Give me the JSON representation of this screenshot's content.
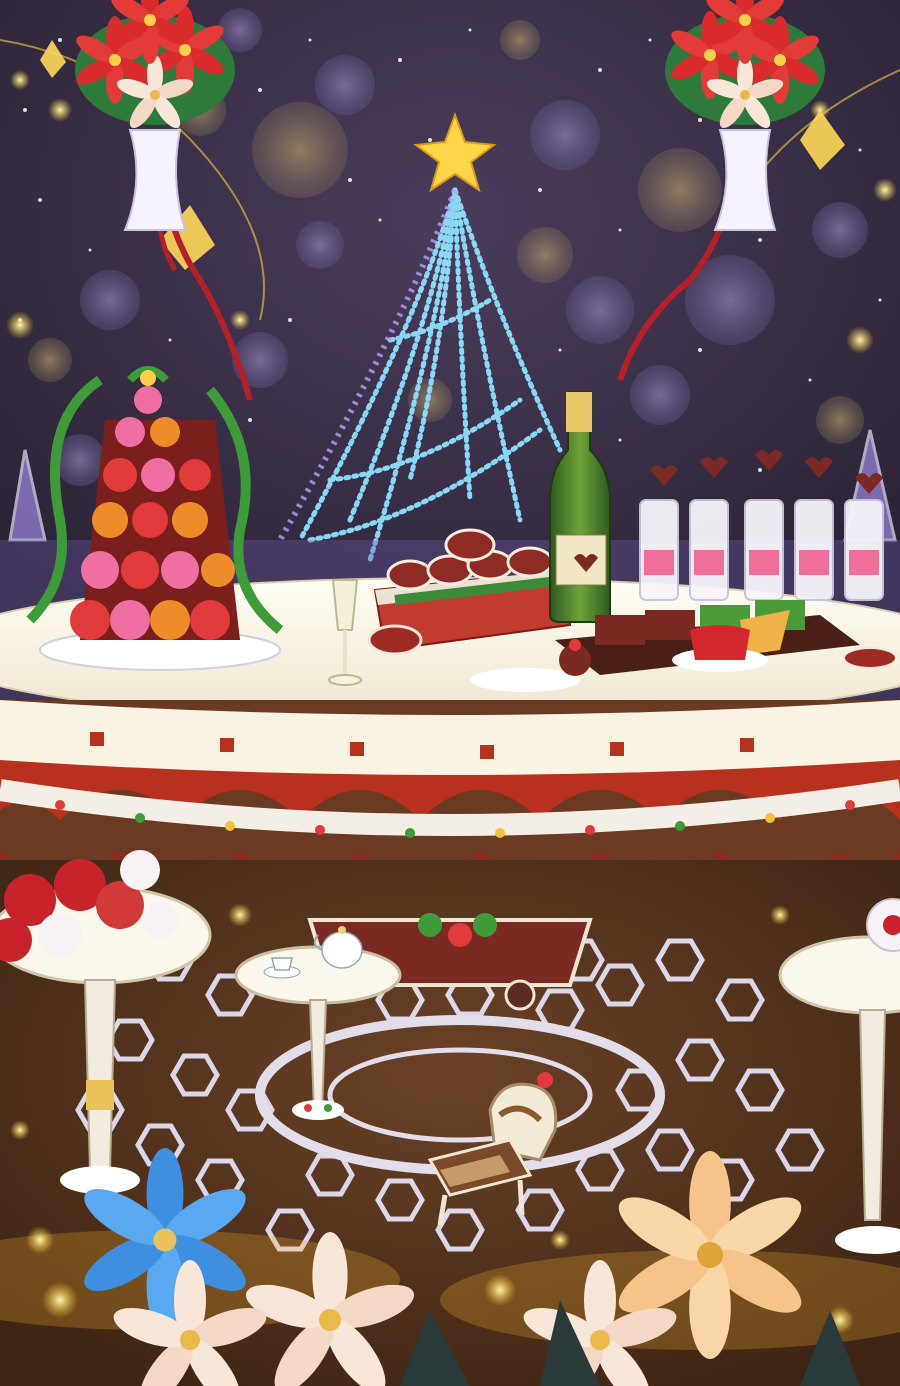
{
  "scene": {
    "kind": "christmas-dessert-party-background",
    "colors": {
      "night_sky": "#3a2f45",
      "bokeh": "#6b5f8a",
      "tree_lights": "#7fd8ff",
      "star_gold": "#ffd54a",
      "tablecloth": "#fbf6ea",
      "drape_red": "#b8301e",
      "floor_brown": "#5a3620",
      "floor_glow": "#e8e6ff",
      "poinsettia_red": "#d92b2b",
      "poinsettia_blue": "#3f8fe0",
      "poinsettia_peach": "#f6c48a"
    },
    "objects": [
      "poinsettia-bouquet-left",
      "poinsettia-bouquet-right",
      "christmas-light-tree",
      "macaron-tower",
      "champagne-bottle",
      "champagne-glass",
      "dessert-cups",
      "heart-cookie-box",
      "cake-plates",
      "tea-table",
      "rose-table",
      "floor-hexagon-pattern",
      "pastry-chair",
      "poinsettia-foreground"
    ]
  }
}
